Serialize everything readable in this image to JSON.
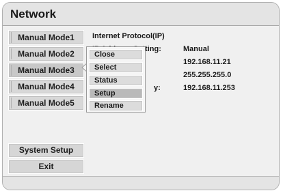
{
  "window": {
    "title": "Network"
  },
  "modes": [
    {
      "label": "Manual Mode1"
    },
    {
      "label": "Manual Mode2"
    },
    {
      "label": "Manual Mode3",
      "selected": true
    },
    {
      "label": "Manual Mode4"
    },
    {
      "label": "Manual Mode5"
    }
  ],
  "actions": {
    "system_setup": "System Setup",
    "exit": "Exit"
  },
  "info": {
    "heading": "Internet Protocol(IP)",
    "ip_setting_label": "IP Address Setting:",
    "ip_setting_value": "Manual",
    "ip_address": "192.168.11.21",
    "subnet_mask": "255.255.255.0",
    "gateway_label_tail": "y:",
    "gateway": "192.168.11.253"
  },
  "context_menu": {
    "items": [
      "Close",
      "Select",
      "Status",
      "Setup",
      "Rename"
    ],
    "highlighted": "Setup"
  },
  "colors": {
    "panel": "#f0f0f0",
    "title_bar": "#e4e4e4",
    "button": "#d8d8d8",
    "highlight": "#b9b9b9"
  }
}
